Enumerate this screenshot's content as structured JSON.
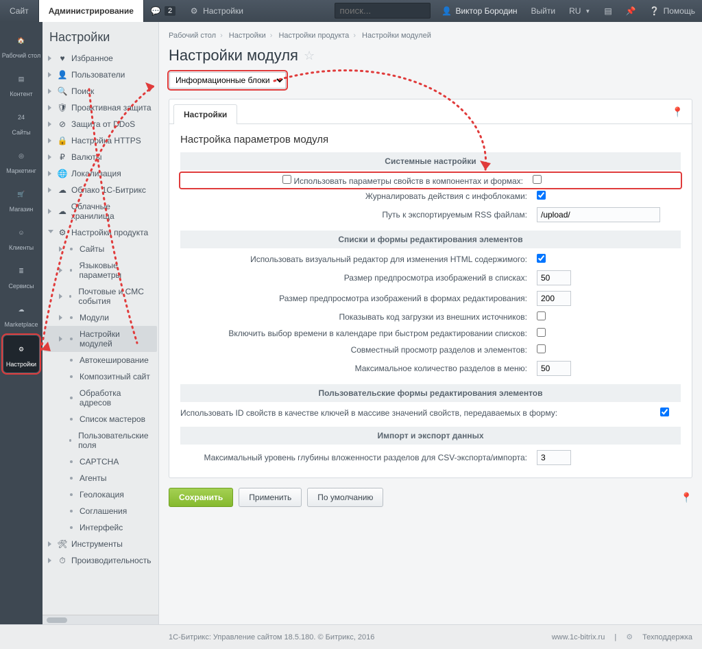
{
  "topbar": {
    "tab_site": "Сайт",
    "tab_admin": "Администрирование",
    "notif_count": "2",
    "settings": "Настройки",
    "search_placeholder": "поиск...",
    "user_name": "Виктор Бородин",
    "logout": "Выйти",
    "lang": "RU",
    "help": "Помощь"
  },
  "rail": [
    {
      "label": "Рабочий стол"
    },
    {
      "label": "Контент"
    },
    {
      "label": "Сайты"
    },
    {
      "label": "Маркетинг"
    },
    {
      "label": "Магазин"
    },
    {
      "label": "Клиенты"
    },
    {
      "label": "Сервисы"
    },
    {
      "label": "Marketplace"
    },
    {
      "label": "Настройки"
    }
  ],
  "sidebar": {
    "title": "Настройки",
    "l1": [
      {
        "label": "Избранное",
        "icon": "heart"
      },
      {
        "label": "Пользователи",
        "icon": "user"
      },
      {
        "label": "Поиск",
        "icon": "search"
      },
      {
        "label": "Проактивная защита",
        "icon": "shield"
      },
      {
        "label": "Защита от DDoS",
        "icon": "ddos"
      },
      {
        "label": "Настройка HTTPS",
        "icon": "lock"
      },
      {
        "label": "Валюты",
        "icon": "currency"
      },
      {
        "label": "Локализация",
        "icon": "globe"
      },
      {
        "label": "Облако 1С-Битрикс",
        "icon": "cloud"
      },
      {
        "label": "Облачные хранилища",
        "icon": "storage"
      }
    ],
    "prod": {
      "label": "Настройки продукта",
      "icon": "gear"
    },
    "l2": [
      {
        "label": "Сайты"
      },
      {
        "label": "Языковые параметры"
      },
      {
        "label": "Почтовые и СМС события"
      },
      {
        "label": "Модули"
      },
      {
        "label": "Настройки модулей"
      },
      {
        "label": "Автокеширование"
      },
      {
        "label": "Композитный сайт"
      },
      {
        "label": "Обработка адресов"
      },
      {
        "label": "Список мастеров"
      },
      {
        "label": "Пользовательские поля"
      },
      {
        "label": "CAPTCHA"
      },
      {
        "label": "Агенты"
      },
      {
        "label": "Геолокация"
      },
      {
        "label": "Соглашения"
      },
      {
        "label": "Интерфейс"
      }
    ],
    "tail": [
      {
        "label": "Инструменты",
        "icon": "tools"
      },
      {
        "label": "Производительность",
        "icon": "perf"
      }
    ]
  },
  "breadcrumb": [
    "Рабочий стол",
    "Настройки",
    "Настройки продукта",
    "Настройки модулей"
  ],
  "page_title": "Настройки модуля",
  "module_select": "Информационные блоки",
  "tab_active": "Настройки",
  "form": {
    "heading": "Настройка параметров модуля",
    "sec_system": "Системные настройки",
    "f_use_props": "Использовать параметры свойств в компонентах и формах:",
    "f_log": "Журналировать действия с инфоблоками:",
    "f_rss_path_l": "Путь к экспортируемым RSS файлам:",
    "f_rss_path_v": "/upload/",
    "sec_lists": "Списки и формы редактирования элементов",
    "f_visual": "Использовать визуальный редактор для изменения HTML содержимого:",
    "f_prev_list_l": "Размер предпросмотра изображений в списках:",
    "f_prev_list_v": "50",
    "f_prev_form_l": "Размер предпросмотра изображений в формах редактирования:",
    "f_prev_form_v": "200",
    "f_extcode": "Показывать код загрузки из внешних источников:",
    "f_calendar": "Включить выбор времени в календаре при быстром редактировании списков:",
    "f_joint": "Совместный просмотр разделов и элементов:",
    "f_maxsec_l": "Максимальное количество разделов в меню:",
    "f_maxsec_v": "50",
    "sec_userforms": "Пользовательские формы редактирования элементов",
    "f_idkeys": "Использовать ID свойств в качестве ключей в массиве значений свойств, передаваемых в форму:",
    "sec_import": "Импорт и экспорт данных",
    "f_csv_l": "Максимальный уровень глубины вложенности разделов для CSV-экспорта/импорта:",
    "f_csv_v": "3",
    "btn_save": "Сохранить",
    "btn_apply": "Применить",
    "btn_default": "По умолчанию"
  },
  "footer": {
    "left": "1С-Битрикс: Управление сайтом 18.5.180. © Битрикс, 2016",
    "site": "www.1c-bitrix.ru",
    "support": "Техподдержка"
  }
}
